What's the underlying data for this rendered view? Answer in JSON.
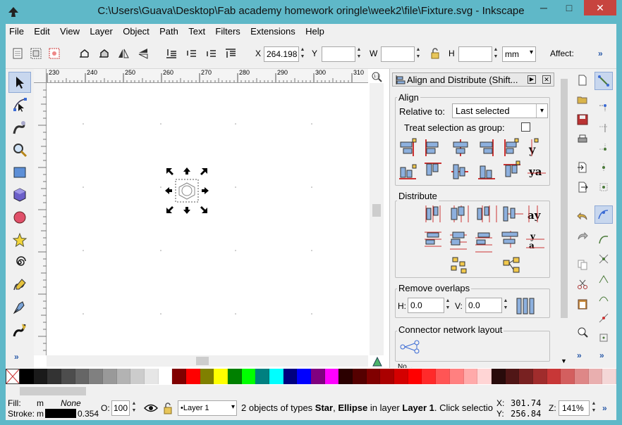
{
  "window": {
    "title": "C:\\Users\\Guava\\Desktop\\Fab academy homework oringle\\week2\\file\\Fixture.svg - Inkscape",
    "minimize": "─",
    "maximize": "□",
    "close": "✕"
  },
  "menu": [
    "File",
    "Edit",
    "View",
    "Layer",
    "Object",
    "Path",
    "Text",
    "Filters",
    "Extensions",
    "Help"
  ],
  "toolbar": {
    "x_label": "X",
    "x_value": "264.198",
    "y_label": "Y",
    "y_value": "",
    "w_label": "W",
    "w_value": "",
    "h_label": "H",
    "h_value": "",
    "unit": "mm",
    "affect": "Affect:",
    "overflow": "»"
  },
  "ruler": {
    "ticks": [
      "230",
      "240",
      "250",
      "260",
      "270",
      "280",
      "290",
      "300",
      "310"
    ]
  },
  "panel": {
    "title": "Align and Distribute (Shift...",
    "align_title": "Align",
    "relative_label": "Relative to:",
    "relative_value": "Last selected",
    "treat_group_label": "Treat selection as group:",
    "distribute_title": "Distribute",
    "remove_overlaps_title": "Remove overlaps",
    "h_label": "H:",
    "h_value": "0.0",
    "v_label": "V:",
    "v_value": "0.0",
    "connector_title": "Connector network layout",
    "cut_label": "No..."
  },
  "status": {
    "fill_label": "Fill:",
    "fill_value": "m",
    "fill_none": "None",
    "stroke_label": "Stroke:",
    "stroke_value": "m",
    "stroke_width": "0.354",
    "opacity_label": "O:",
    "opacity_value": "100",
    "layer": "•Layer 1",
    "msg_prefix": "2 objects of types ",
    "msg_star": "Star",
    "msg_comma": ", ",
    "msg_ellipse": "Ellipse",
    "msg_in": " in layer ",
    "msg_layer": "Layer 1",
    "msg_suffix": ". Click selectio",
    "x_label": "X:",
    "x_value": "301.74",
    "y_label": "Y:",
    "y_value": "256.84",
    "zoom_label": "Z:",
    "zoom_value": "141%",
    "expand": "»"
  },
  "left_overflow": "»",
  "palette_colors": [
    "#000000",
    "#1a1a1a",
    "#333333",
    "#4d4d4d",
    "#666666",
    "#808080",
    "#999999",
    "#b3b3b3",
    "#cccccc",
    "#e6e6e6",
    "#ffffff",
    "#800000",
    "#ff0000",
    "#808000",
    "#ffff00",
    "#008000",
    "#00ff00",
    "#008080",
    "#00ffff",
    "#000080",
    "#0000ff",
    "#800080",
    "#ff00ff",
    "#2b0000",
    "#550000",
    "#800000",
    "#aa0000",
    "#d40000",
    "#ff0000",
    "#ff2a2a",
    "#ff5555",
    "#ff8080",
    "#ffaaaa",
    "#ffd5d5",
    "#280b0b",
    "#501616",
    "#782121",
    "#a02c2c",
    "#c83737",
    "#d35f5f",
    "#de8787",
    "#e9afaf",
    "#f4d7d7"
  ]
}
